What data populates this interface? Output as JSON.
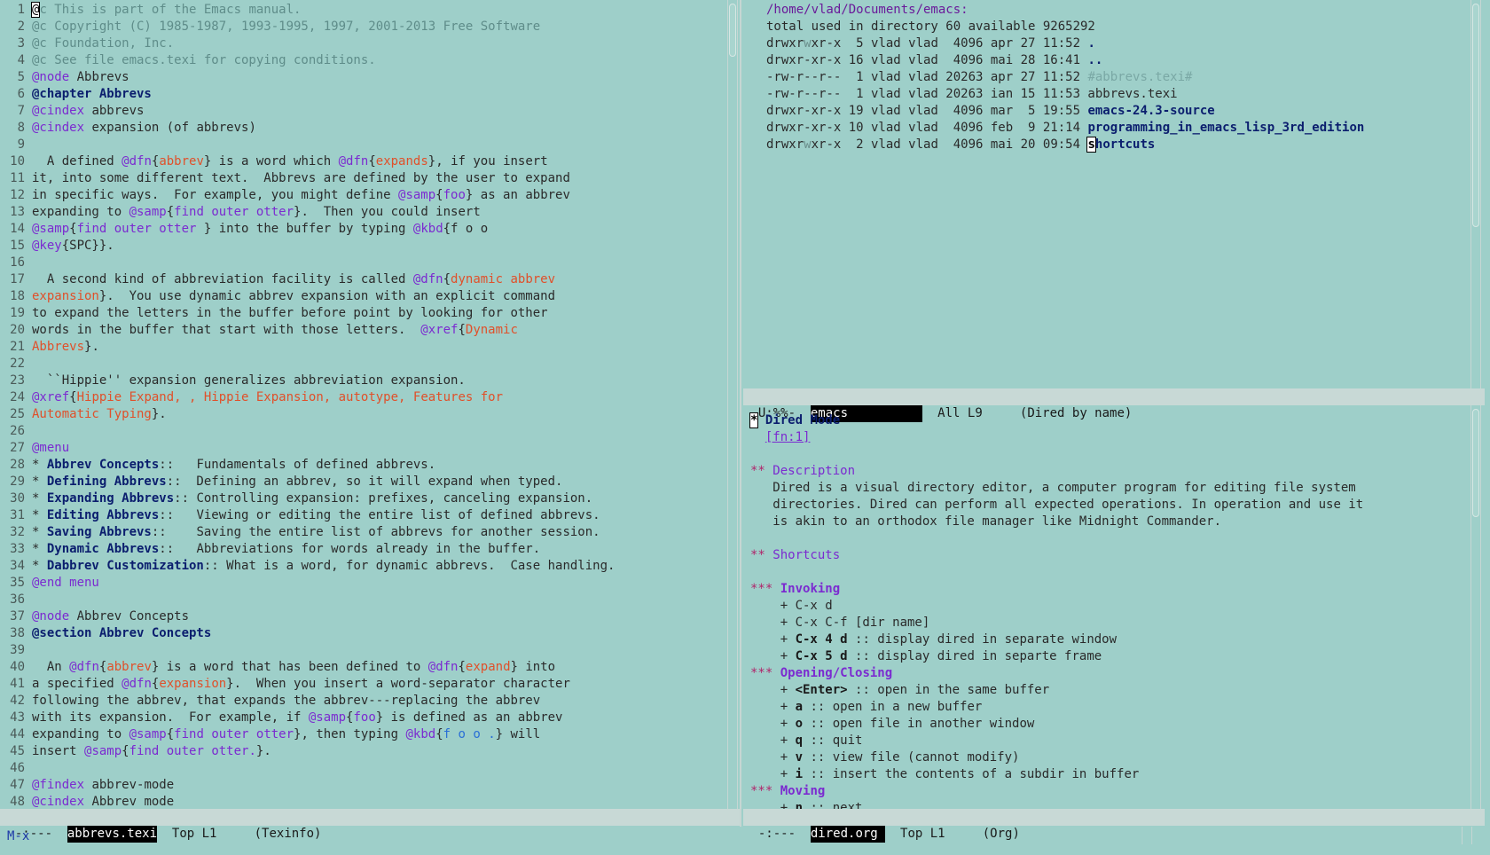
{
  "left": {
    "lines": [
      {
        "n": "1",
        "s": [
          {
            "c": "cursor",
            "t": "@"
          },
          {
            "c": "cm",
            "t": "c This is part of the Emacs manual."
          }
        ]
      },
      {
        "n": "2",
        "s": [
          {
            "c": "cm",
            "t": "@c Copyright (C) 1985-1987, 1993-1995, 1997, 2001-2013 Free Software"
          }
        ]
      },
      {
        "n": "3",
        "s": [
          {
            "c": "cm",
            "t": "@c Foundation, Inc."
          }
        ]
      },
      {
        "n": "4",
        "s": [
          {
            "c": "cm",
            "t": "@c See file emacs.texi for copying conditions."
          }
        ]
      },
      {
        "n": "5",
        "s": [
          {
            "c": "kw",
            "t": "@node"
          },
          {
            "c": "plain",
            "t": " Abbrevs"
          }
        ]
      },
      {
        "n": "6",
        "s": [
          {
            "c": "kwb",
            "t": "@chapter Abbrevs"
          }
        ]
      },
      {
        "n": "7",
        "s": [
          {
            "c": "kw",
            "t": "@cindex"
          },
          {
            "c": "plain",
            "t": " abbrevs"
          }
        ]
      },
      {
        "n": "8",
        "s": [
          {
            "c": "kw",
            "t": "@cindex"
          },
          {
            "c": "plain",
            "t": " expansion (of abbrevs)"
          }
        ]
      },
      {
        "n": "9",
        "s": []
      },
      {
        "n": "10",
        "s": [
          {
            "c": "plain",
            "t": "  A defined "
          },
          {
            "c": "kw",
            "t": "@dfn"
          },
          {
            "c": "plain",
            "t": "{"
          },
          {
            "c": "arg",
            "t": "abbrev"
          },
          {
            "c": "plain",
            "t": "} is a word which "
          },
          {
            "c": "kw",
            "t": "@dfn"
          },
          {
            "c": "plain",
            "t": "{"
          },
          {
            "c": "arg",
            "t": "expands"
          },
          {
            "c": "plain",
            "t": "}, if you insert"
          }
        ]
      },
      {
        "n": "11",
        "s": [
          {
            "c": "plain",
            "t": "it, into some different text.  Abbrevs are defined by the user to expand"
          }
        ]
      },
      {
        "n": "12",
        "s": [
          {
            "c": "plain",
            "t": "in specific ways.  For example, you might define "
          },
          {
            "c": "kw",
            "t": "@samp"
          },
          {
            "c": "plain",
            "t": "{"
          },
          {
            "c": "kw",
            "t": "foo"
          },
          {
            "c": "plain",
            "t": "} as an abbrev"
          }
        ]
      },
      {
        "n": "13",
        "s": [
          {
            "c": "plain",
            "t": "expanding to "
          },
          {
            "c": "kw",
            "t": "@samp"
          },
          {
            "c": "plain",
            "t": "{"
          },
          {
            "c": "kw",
            "t": "find outer otter"
          },
          {
            "c": "plain",
            "t": "}.  Then you could insert"
          }
        ]
      },
      {
        "n": "14",
        "s": [
          {
            "c": "kw",
            "t": "@samp"
          },
          {
            "c": "plain",
            "t": "{"
          },
          {
            "c": "kw",
            "t": "find outer otter "
          },
          {
            "c": "plain",
            "t": "} into the buffer by typing "
          },
          {
            "c": "kw",
            "t": "@kbd"
          },
          {
            "c": "plain",
            "t": "{f o o"
          }
        ]
      },
      {
        "n": "15",
        "s": [
          {
            "c": "kw",
            "t": "@key"
          },
          {
            "c": "plain",
            "t": "{SPC}}."
          }
        ]
      },
      {
        "n": "16",
        "s": []
      },
      {
        "n": "17",
        "s": [
          {
            "c": "plain",
            "t": "  A second kind of abbreviation facility is called "
          },
          {
            "c": "kw",
            "t": "@dfn"
          },
          {
            "c": "plain",
            "t": "{"
          },
          {
            "c": "arg",
            "t": "dynamic abbrev"
          }
        ]
      },
      {
        "n": "18",
        "s": [
          {
            "c": "arg",
            "t": "expansion"
          },
          {
            "c": "plain",
            "t": "}.  You use dynamic abbrev expansion with an explicit command"
          }
        ]
      },
      {
        "n": "19",
        "s": [
          {
            "c": "plain",
            "t": "to expand the letters in the buffer before point by looking for other"
          }
        ]
      },
      {
        "n": "20",
        "s": [
          {
            "c": "plain",
            "t": "words in the buffer that start with those letters.  "
          },
          {
            "c": "kw",
            "t": "@xref"
          },
          {
            "c": "plain",
            "t": "{"
          },
          {
            "c": "arg",
            "t": "Dynamic"
          }
        ]
      },
      {
        "n": "21",
        "s": [
          {
            "c": "arg",
            "t": "Abbrevs"
          },
          {
            "c": "plain",
            "t": "}."
          }
        ]
      },
      {
        "n": "22",
        "s": []
      },
      {
        "n": "23",
        "s": [
          {
            "c": "plain",
            "t": "  ``Hippie'' expansion generalizes abbreviation expansion."
          }
        ]
      },
      {
        "n": "24",
        "s": [
          {
            "c": "kw",
            "t": "@xref"
          },
          {
            "c": "plain",
            "t": "{"
          },
          {
            "c": "arg",
            "t": "Hippie Expand, , Hippie Expansion, autotype, Features for"
          }
        ]
      },
      {
        "n": "25",
        "s": [
          {
            "c": "arg",
            "t": "Automatic Typing"
          },
          {
            "c": "plain",
            "t": "}."
          }
        ]
      },
      {
        "n": "26",
        "s": []
      },
      {
        "n": "27",
        "s": [
          {
            "c": "kw",
            "t": "@menu"
          }
        ]
      },
      {
        "n": "28",
        "s": [
          {
            "c": "plain",
            "t": "* "
          },
          {
            "c": "kwb",
            "t": "Abbrev Concepts"
          },
          {
            "c": "plain",
            "t": "::   Fundamentals of defined abbrevs."
          }
        ]
      },
      {
        "n": "29",
        "s": [
          {
            "c": "plain",
            "t": "* "
          },
          {
            "c": "kwb",
            "t": "Defining Abbrevs"
          },
          {
            "c": "plain",
            "t": "::  Defining an abbrev, so it will expand when typed."
          }
        ]
      },
      {
        "n": "30",
        "s": [
          {
            "c": "plain",
            "t": "* "
          },
          {
            "c": "kwb",
            "t": "Expanding Abbrevs"
          },
          {
            "c": "plain",
            "t": ":: Controlling expansion: prefixes, canceling expansion."
          }
        ]
      },
      {
        "n": "31",
        "s": [
          {
            "c": "plain",
            "t": "* "
          },
          {
            "c": "kwb",
            "t": "Editing Abbrevs"
          },
          {
            "c": "plain",
            "t": "::   Viewing or editing the entire list of defined abbrevs."
          }
        ]
      },
      {
        "n": "32",
        "s": [
          {
            "c": "plain",
            "t": "* "
          },
          {
            "c": "kwb",
            "t": "Saving Abbrevs"
          },
          {
            "c": "plain",
            "t": "::    Saving the entire list of abbrevs for another session."
          }
        ]
      },
      {
        "n": "33",
        "s": [
          {
            "c": "plain",
            "t": "* "
          },
          {
            "c": "kwb",
            "t": "Dynamic Abbrevs"
          },
          {
            "c": "plain",
            "t": "::   Abbreviations for words already in the buffer."
          }
        ]
      },
      {
        "n": "34",
        "s": [
          {
            "c": "plain",
            "t": "* "
          },
          {
            "c": "kwb",
            "t": "Dabbrev Customization"
          },
          {
            "c": "plain",
            "t": ":: What is a word, for dynamic abbrevs.  Case handling."
          }
        ]
      },
      {
        "n": "35",
        "s": [
          {
            "c": "kw",
            "t": "@end menu"
          }
        ]
      },
      {
        "n": "36",
        "s": []
      },
      {
        "n": "37",
        "s": [
          {
            "c": "kw",
            "t": "@node"
          },
          {
            "c": "plain",
            "t": " Abbrev Concepts"
          }
        ]
      },
      {
        "n": "38",
        "s": [
          {
            "c": "kwb",
            "t": "@section Abbrev Concepts"
          }
        ]
      },
      {
        "n": "39",
        "s": []
      },
      {
        "n": "40",
        "s": [
          {
            "c": "plain",
            "t": "  An "
          },
          {
            "c": "kw",
            "t": "@dfn"
          },
          {
            "c": "plain",
            "t": "{"
          },
          {
            "c": "arg",
            "t": "abbrev"
          },
          {
            "c": "plain",
            "t": "} is a word that has been defined to "
          },
          {
            "c": "kw",
            "t": "@dfn"
          },
          {
            "c": "plain",
            "t": "{"
          },
          {
            "c": "arg",
            "t": "expand"
          },
          {
            "c": "plain",
            "t": "} into"
          }
        ]
      },
      {
        "n": "41",
        "s": [
          {
            "c": "plain",
            "t": "a specified "
          },
          {
            "c": "kw",
            "t": "@dfn"
          },
          {
            "c": "plain",
            "t": "{"
          },
          {
            "c": "arg",
            "t": "expansion"
          },
          {
            "c": "plain",
            "t": "}.  When you insert a word-separator character"
          }
        ]
      },
      {
        "n": "42",
        "s": [
          {
            "c": "plain",
            "t": "following the abbrev, that expands the abbrev---replacing the abbrev"
          }
        ]
      },
      {
        "n": "43",
        "s": [
          {
            "c": "plain",
            "t": "with its expansion.  For example, if "
          },
          {
            "c": "kw",
            "t": "@samp"
          },
          {
            "c": "plain",
            "t": "{"
          },
          {
            "c": "kw",
            "t": "foo"
          },
          {
            "c": "plain",
            "t": "} is defined as an abbrev"
          }
        ]
      },
      {
        "n": "44",
        "s": [
          {
            "c": "plain",
            "t": "expanding to "
          },
          {
            "c": "kw",
            "t": "@samp"
          },
          {
            "c": "plain",
            "t": "{"
          },
          {
            "c": "kw",
            "t": "find outer otter"
          },
          {
            "c": "plain",
            "t": "}, then typing "
          },
          {
            "c": "kw",
            "t": "@kbd"
          },
          {
            "c": "plain",
            "t": "{"
          },
          {
            "c": "kwlink",
            "t": "f o o ."
          },
          {
            "c": "plain",
            "t": "} will"
          }
        ]
      },
      {
        "n": "45",
        "s": [
          {
            "c": "plain",
            "t": "insert "
          },
          {
            "c": "kw",
            "t": "@samp"
          },
          {
            "c": "plain",
            "t": "{"
          },
          {
            "c": "kw",
            "t": "find outer otter."
          },
          {
            "c": "plain",
            "t": "}."
          }
        ]
      },
      {
        "n": "46",
        "s": []
      },
      {
        "n": "47",
        "s": [
          {
            "c": "kw",
            "t": "@findex"
          },
          {
            "c": "plain",
            "t": " abbrev-mode"
          }
        ]
      },
      {
        "n": "48",
        "s": [
          {
            "c": "kw",
            "t": "@cindex"
          },
          {
            "c": "plain",
            "t": " Abbrev mode"
          }
        ]
      }
    ],
    "modeline": {
      "status": "-:---  ",
      "buffer": "abbrevs.texi",
      "pos": "  Top L1     ",
      "mode": "(Texinfo)"
    }
  },
  "dired": {
    "lines": [
      [
        {
          "c": "dirhdr",
          "t": "/home/vlad/Documents/emacs:"
        }
      ],
      [
        {
          "c": "plain",
          "t": "total used in directory 60 available 9265292"
        }
      ],
      [
        {
          "c": "plain",
          "t": "drwxr"
        },
        {
          "c": "wx",
          "t": "w"
        },
        {
          "c": "plain",
          "t": "xr-x  5 vlad vlad  4096 apr 27 11:52 "
        },
        {
          "c": "dirb",
          "t": "."
        }
      ],
      [
        {
          "c": "plain",
          "t": "drwxr-xr-x 16 vlad vlad  4096 mai 28 16:41 "
        },
        {
          "c": "dirb",
          "t": ".."
        }
      ],
      [
        {
          "c": "plain",
          "t": "-rw-r--r--  1 vlad vlad 20263 apr 27 11:52 "
        },
        {
          "c": "hidden",
          "t": "#abbrevs.texi#"
        }
      ],
      [
        {
          "c": "plain",
          "t": "-rw-r--r--  1 vlad vlad 20263 ian 15 11:53 abbrevs.texi"
        }
      ],
      [
        {
          "c": "plain",
          "t": "drwxr-xr-x 19 vlad vlad  4096 mar  5 19:55 "
        },
        {
          "c": "dirb",
          "t": "emacs-24.3-source"
        }
      ],
      [
        {
          "c": "plain",
          "t": "drwxr-xr-x 10 vlad vlad  4096 feb  9 21:14 "
        },
        {
          "c": "dirb",
          "t": "programming_in_emacs_lisp_3rd_edition"
        }
      ],
      [
        {
          "c": "plain",
          "t": "drwxr"
        },
        {
          "c": "wx",
          "t": "w"
        },
        {
          "c": "plain",
          "t": "xr-x  2 vlad vlad  4096 mai 20 09:54 "
        },
        {
          "c": "cursorb",
          "t": "s"
        },
        {
          "c": "dirb",
          "t": "hortcuts"
        }
      ]
    ],
    "modeline": {
      "status": "U:%%-  ",
      "buffer": "emacs          ",
      "pos": "  All L9     ",
      "mode": "(Dired by name)"
    }
  },
  "org": {
    "lines": [
      [
        {
          "c": "cursorb",
          "t": "*"
        },
        {
          "c": "orgh1",
          "t": " Dired Mode"
        }
      ],
      [
        {
          "c": "plain",
          "t": "  "
        },
        {
          "c": "link",
          "t": "[fn:1]"
        }
      ],
      [],
      [
        {
          "c": "orgstar",
          "t": "**"
        },
        {
          "c": "orgh2",
          "t": " Description"
        }
      ],
      [
        {
          "c": "plain",
          "t": "   Dired is a visual directory editor, a computer program for editing file system"
        }
      ],
      [
        {
          "c": "plain",
          "t": "   directories. Dired can perform all expected operations. In operation and use it"
        }
      ],
      [
        {
          "c": "plain",
          "t": "   is akin to an orthodox file manager like Midnight Commander."
        }
      ],
      [],
      [
        {
          "c": "orgstar",
          "t": "**"
        },
        {
          "c": "orgh2",
          "t": " Shortcuts"
        }
      ],
      [],
      [
        {
          "c": "orgstar",
          "t": "***"
        },
        {
          "c": "orgh3",
          "t": " Invoking"
        }
      ],
      [
        {
          "c": "plain",
          "t": "    + C-x d"
        }
      ],
      [
        {
          "c": "plain",
          "t": "    + C-x C-f [dir name]"
        }
      ],
      [
        {
          "c": "plain",
          "t": "    + "
        },
        {
          "c": "bold",
          "t": "C-x 4 d"
        },
        {
          "c": "plain",
          "t": " :: display dired in separate window"
        }
      ],
      [
        {
          "c": "plain",
          "t": "    + "
        },
        {
          "c": "bold",
          "t": "C-x 5 d"
        },
        {
          "c": "plain",
          "t": " :: display dired in separte frame"
        }
      ],
      [
        {
          "c": "orgstar",
          "t": "***"
        },
        {
          "c": "orgh3",
          "t": " Opening/Closing"
        }
      ],
      [
        {
          "c": "plain",
          "t": "    + "
        },
        {
          "c": "bold",
          "t": "<Enter>"
        },
        {
          "c": "plain",
          "t": " :: open in the same buffer"
        }
      ],
      [
        {
          "c": "plain",
          "t": "    + "
        },
        {
          "c": "bold",
          "t": "a"
        },
        {
          "c": "plain",
          "t": " :: open in a new buffer"
        }
      ],
      [
        {
          "c": "plain",
          "t": "    + "
        },
        {
          "c": "bold",
          "t": "o"
        },
        {
          "c": "plain",
          "t": " :: open file in another window"
        }
      ],
      [
        {
          "c": "plain",
          "t": "    + "
        },
        {
          "c": "bold",
          "t": "q"
        },
        {
          "c": "plain",
          "t": " :: quit"
        }
      ],
      [
        {
          "c": "plain",
          "t": "    + "
        },
        {
          "c": "bold",
          "t": "v"
        },
        {
          "c": "plain",
          "t": " :: view file (cannot modify)"
        }
      ],
      [
        {
          "c": "plain",
          "t": "    + "
        },
        {
          "c": "bold",
          "t": "i"
        },
        {
          "c": "plain",
          "t": " :: insert the contents of a subdir in buffer"
        }
      ],
      [
        {
          "c": "orgstar",
          "t": "***"
        },
        {
          "c": "orgh3",
          "t": " Moving"
        }
      ],
      [
        {
          "c": "plain",
          "t": "    + "
        },
        {
          "c": "bold",
          "t": "n"
        },
        {
          "c": "plain",
          "t": " :: next"
        }
      ]
    ],
    "modeline": {
      "status": "-:---  ",
      "buffer": "dired.org ",
      "pos": "  Top L1     ",
      "mode": "(Org)"
    }
  },
  "minibuffer": {
    "text": "M-x"
  },
  "colors": {
    "background": "#9ecfc9",
    "keyword": "#7b2bd0",
    "argument": "#e0502a",
    "heading": "#0b1e6e",
    "comment": "#5f8d8a"
  }
}
